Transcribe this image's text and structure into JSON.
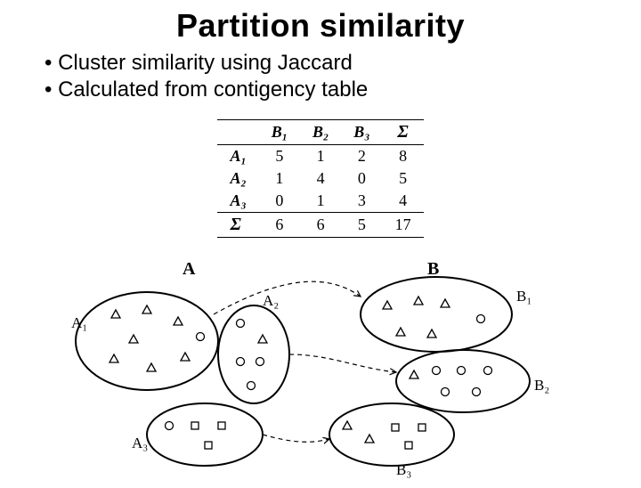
{
  "title": "Partition similarity",
  "bullets": [
    "Cluster similarity using Jaccard",
    "Calculated from contigency table"
  ],
  "table": {
    "col_headers": [
      "B₁",
      "B₂",
      "B₃",
      "Σ"
    ],
    "rows": [
      {
        "name": "A₁",
        "cells": [
          5,
          1,
          2,
          8
        ]
      },
      {
        "name": "A₂",
        "cells": [
          1,
          4,
          0,
          5
        ]
      },
      {
        "name": "A₃",
        "cells": [
          0,
          1,
          3,
          4
        ]
      }
    ],
    "sum_row": {
      "name": "Σ",
      "cells": [
        6,
        6,
        5,
        17
      ]
    }
  },
  "diagram": {
    "labels": {
      "A": "A",
      "B": "B",
      "A1": "A₁",
      "A2": "A₂",
      "A3": "A₃",
      "B1": "B₁",
      "B2": "B₂",
      "B3": "B₃"
    }
  },
  "chart_data": {
    "type": "table",
    "title": "Contingency table of partitions A and B",
    "columns": [
      "B1",
      "B2",
      "B3",
      "Σ"
    ],
    "rows": [
      "A1",
      "A2",
      "A3",
      "Σ"
    ],
    "values": [
      [
        5,
        1,
        2,
        8
      ],
      [
        1,
        4,
        0,
        5
      ],
      [
        0,
        1,
        3,
        4
      ],
      [
        6,
        6,
        5,
        17
      ]
    ]
  }
}
